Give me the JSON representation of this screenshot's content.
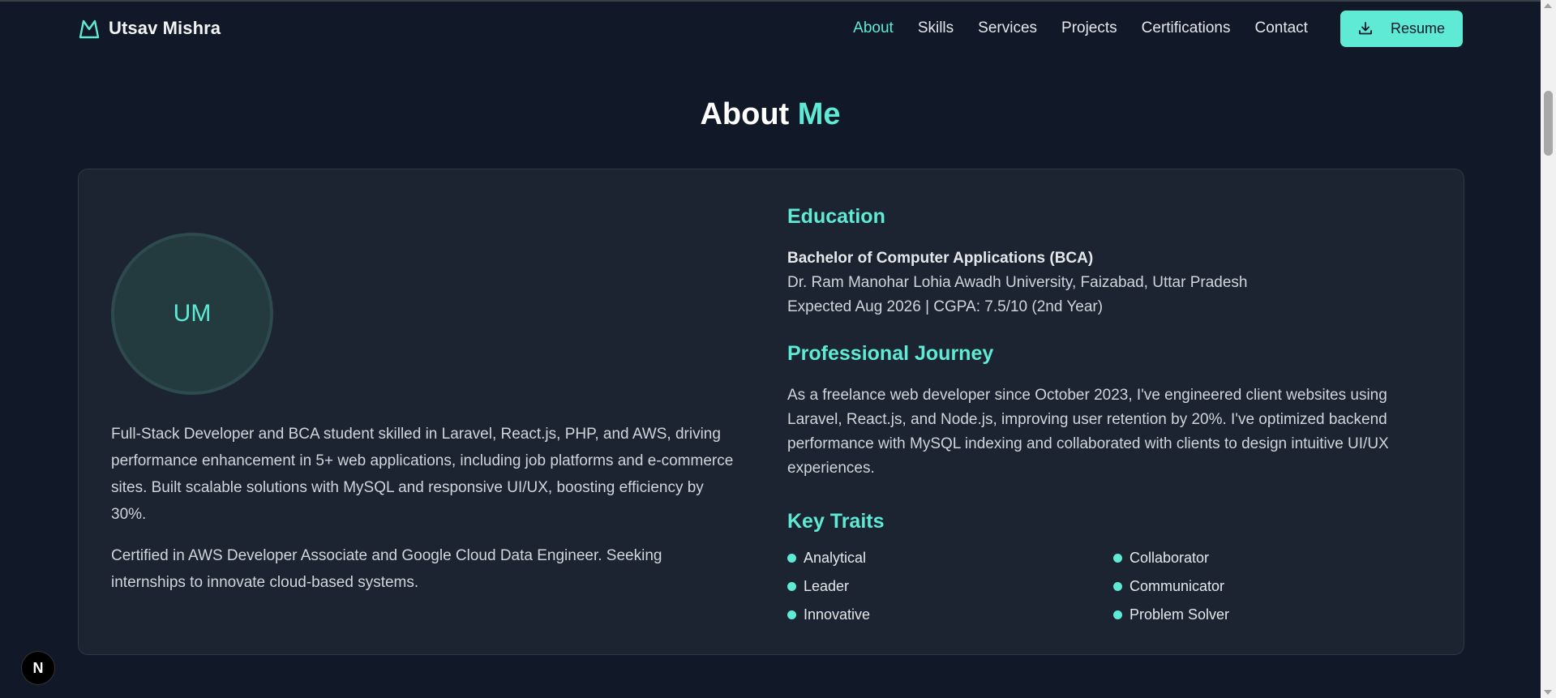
{
  "brand": {
    "name": "Utsav Mishra",
    "logo_icon": "mountain-logo-icon"
  },
  "nav": {
    "items": [
      {
        "label": "About",
        "active": true
      },
      {
        "label": "Skills",
        "active": false
      },
      {
        "label": "Services",
        "active": false
      },
      {
        "label": "Projects",
        "active": false
      },
      {
        "label": "Certifications",
        "active": false
      },
      {
        "label": "Contact",
        "active": false
      }
    ],
    "resume_label": "Resume",
    "resume_icon": "download-icon"
  },
  "section": {
    "title_main": "About",
    "title_accent": "Me"
  },
  "profile": {
    "initials": "UM",
    "bio": [
      "Full-Stack Developer and BCA student skilled in Laravel, React.js, PHP, and AWS, driving performance enhancement in 5+ web applications, including job platforms and e-commerce sites. Built scalable solutions with MySQL and responsive UI/UX, boosting efficiency by 30%.",
      "Certified in AWS Developer Associate and Google Cloud Data Engineer. Seeking internships to innovate cloud-based systems."
    ]
  },
  "education": {
    "heading": "Education",
    "degree": "Bachelor of Computer Applications (BCA)",
    "university": "Dr. Ram Manohar Lohia Awadh University, Faizabad, Uttar Pradesh",
    "details": "Expected Aug 2026 | CGPA: 7.5/10 (2nd Year)"
  },
  "journey": {
    "heading": "Professional Journey",
    "text": "As a freelance web developer since October 2023, I've engineered client websites using Laravel, React.js, and Node.js, improving user retention by 20%. I've optimized backend performance with MySQL indexing and collaborated with clients to design intuitive UI/UX experiences."
  },
  "traits": {
    "heading": "Key Traits",
    "items": [
      "Analytical",
      "Collaborator",
      "Leader",
      "Communicator",
      "Innovative",
      "Problem Solver"
    ]
  },
  "next_badge": {
    "label": "N"
  },
  "colors": {
    "accent": "#5eead4",
    "background": "#111827",
    "card": "#1c2431"
  }
}
